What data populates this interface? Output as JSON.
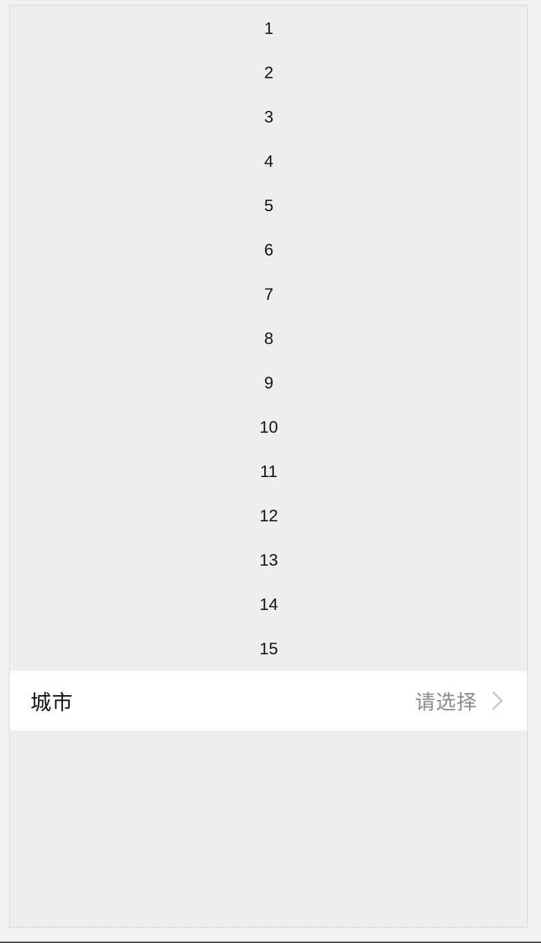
{
  "list": {
    "items": [
      "1",
      "2",
      "3",
      "4",
      "5",
      "6",
      "7",
      "8",
      "9",
      "10",
      "11",
      "12",
      "13",
      "14",
      "15"
    ]
  },
  "city_cell": {
    "label": "城市",
    "value_placeholder": "请选择",
    "arrow_icon": "chevron-right-icon"
  }
}
